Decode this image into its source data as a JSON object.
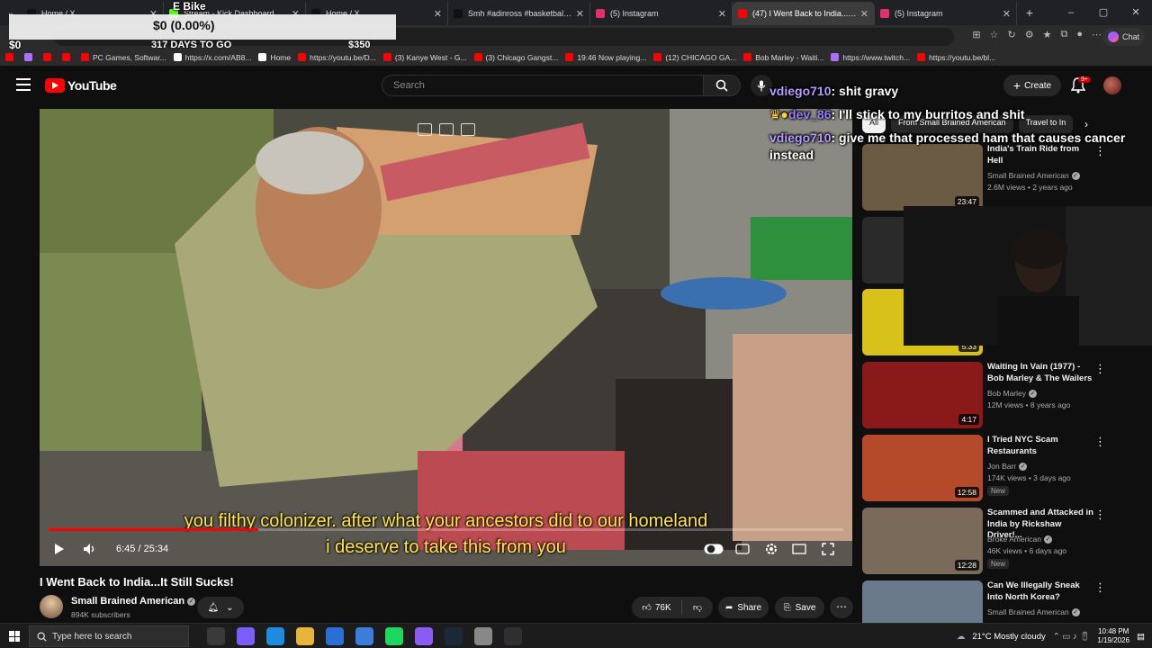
{
  "browser": {
    "tabs": [
      {
        "label": "Home / X",
        "color": "#111111",
        "active": false
      },
      {
        "label": "Stream - Kick Dashboard",
        "color": "#53fc18",
        "active": false
      },
      {
        "label": "Home / X",
        "color": "#111111",
        "active": false
      },
      {
        "label": "Smh #adinross #basketball #psyc",
        "color": "#111111",
        "active": false
      },
      {
        "label": "(5) Instagram",
        "color": "#e1306c",
        "active": false
      },
      {
        "label": "(47) I Went Back to India...It S",
        "color": "#ff0000",
        "active": true
      },
      {
        "label": "(5) Instagram",
        "color": "#e1306c",
        "active": false
      }
    ],
    "new_tab": "+",
    "window_controls": [
      "–",
      "▢",
      "✕"
    ],
    "copilot_label": "Chat",
    "bookmarks": [
      {
        "label": "",
        "color": "#ff0000"
      },
      {
        "label": "",
        "color": "#a970ff"
      },
      {
        "label": "",
        "color": "#ff0000"
      },
      {
        "label": "",
        "color": "#ff0000"
      },
      {
        "label": "PC Games, Softwar...",
        "color": "#ff0000"
      },
      {
        "label": "https://x.com/AB8...",
        "color": "#ffffff"
      },
      {
        "label": "Home",
        "color": "#ffffff"
      },
      {
        "label": "https://youtu.be/D...",
        "color": "#ff0000"
      },
      {
        "label": "(3) Kanye West - G...",
        "color": "#ff0000"
      },
      {
        "label": "(3) Chicago Gangst...",
        "color": "#ff0000"
      },
      {
        "label": "19:46 Now playing...",
        "color": "#ff0000"
      },
      {
        "label": "(12) CHICAGO GA...",
        "color": "#ff0000"
      },
      {
        "label": "Bob Marley - Waiti...",
        "color": "#ff0000"
      },
      {
        "label": "https://www.twitch...",
        "color": "#a970ff"
      },
      {
        "label": "https://youtu.be/bl...",
        "color": "#ff0000"
      }
    ]
  },
  "stream_overlay": {
    "title": "E Bike",
    "amount": "$0 (0.00%)",
    "raised": "$0",
    "days": "317 DAYS TO GO",
    "goal": "$350"
  },
  "youtube": {
    "logo": "YouTube",
    "search_placeholder": "Search",
    "create_label": "Create",
    "notif_badge": "9+"
  },
  "player": {
    "subtitle_line1": "you filthy colonizer. after what your ancestors did to our homeland",
    "subtitle_line2": "i deserve to take this from you",
    "time": "6:45 / 25:34",
    "progress": 0.264
  },
  "chat": [
    {
      "user": "vdiego710",
      "text": "shit gravy"
    },
    {
      "user": "dev_86",
      "text": "I'll stick to my burritos and shit"
    },
    {
      "user": "vdiego710",
      "text": "give me that processed ham that causes cancer instead"
    }
  ],
  "video": {
    "title": "I Went Back to India...It Still Sucks!",
    "channel": "Small Brained American",
    "subscribers": "894K subscribers",
    "likes": "76K",
    "share": "Share",
    "save": "Save"
  },
  "sidebar": {
    "chips": [
      "All",
      "From Small Brained American",
      "Travel to In"
    ],
    "recs": [
      {
        "title": "India's Train Ride from Hell",
        "channel": "Small Brained American",
        "meta": "2.6M views • 2 years ago",
        "duration": "23:47",
        "new": "",
        "thumb": "#6b5a44"
      },
      {
        "title": "",
        "channel": "",
        "meta": "",
        "duration": "",
        "new": "",
        "thumb": "#2a2a2a"
      },
      {
        "title": "",
        "channel": "",
        "meta": "",
        "duration": "5:33",
        "new": "",
        "thumb": "#d8c21a"
      },
      {
        "title": "Waiting In Vain (1977) - Bob Marley & The Wailers",
        "channel": "Bob Marley",
        "meta": "12M views • 8 years ago",
        "duration": "4:17",
        "new": "",
        "thumb": "#8a1a1a"
      },
      {
        "title": "I Tried NYC Scam Restaurants",
        "channel": "Jon Barr",
        "meta": "174K views • 3 days ago",
        "duration": "12:58",
        "new": "New",
        "thumb": "#b54a2a"
      },
      {
        "title": "Scammed and Attacked in India by Rickshaw Driver!...",
        "channel": "Broke American",
        "meta": "46K views • 6 days ago",
        "duration": "12:28",
        "new": "New",
        "thumb": "#7a6a5a"
      },
      {
        "title": "Can We Illegally Sneak Into North Korea?",
        "channel": "Small Brained American",
        "meta": "",
        "duration": "",
        "new": "",
        "thumb": "#6a7a8a"
      }
    ]
  },
  "taskbar": {
    "search_placeholder": "Type here to search",
    "weather": "21°C  Mostly cloudy",
    "time": "10:48 PM",
    "date": "1/19/2026",
    "apps": [
      {
        "name": "task-view",
        "color": "#3a3a3a"
      },
      {
        "name": "copilot",
        "color": "#7a5cff"
      },
      {
        "name": "edge",
        "color": "#1d8ce0"
      },
      {
        "name": "file-explorer",
        "color": "#e8b53a"
      },
      {
        "name": "store",
        "color": "#2a6fd6"
      },
      {
        "name": "app-blue",
        "color": "#3b7ddd"
      },
      {
        "name": "spotify",
        "color": "#1ed760"
      },
      {
        "name": "app-purple",
        "color": "#8a5cf5"
      },
      {
        "name": "steam",
        "color": "#1b2838"
      },
      {
        "name": "app-gray",
        "color": "#888888"
      },
      {
        "name": "obs",
        "color": "#302e31"
      }
    ]
  }
}
